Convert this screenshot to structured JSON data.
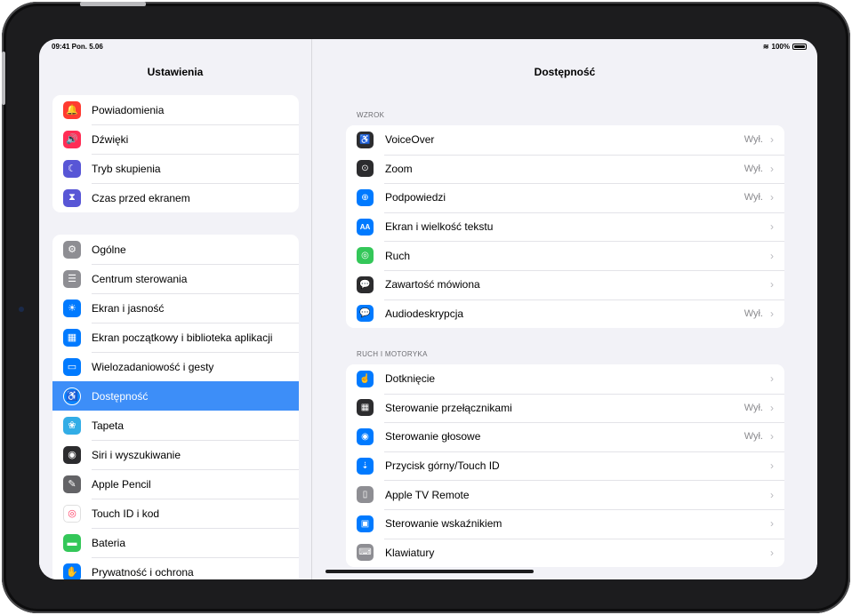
{
  "status": {
    "time": "09:41 Pon. 5.06",
    "battery": "100%"
  },
  "sidebar": {
    "title": "Ustawienia",
    "group1": [
      {
        "label": "Powiadomienia",
        "icon": "bell-icon",
        "color": "#ff3b30",
        "glyph": "🔔"
      },
      {
        "label": "Dźwięki",
        "icon": "speaker-icon",
        "color": "#ff2d55",
        "glyph": "🔊"
      },
      {
        "label": "Tryb skupienia",
        "icon": "moon-icon",
        "color": "#5856d6",
        "glyph": "☾"
      },
      {
        "label": "Czas przed ekranem",
        "icon": "hourglass-icon",
        "color": "#5856d6",
        "glyph": "⧗"
      }
    ],
    "group2": [
      {
        "label": "Ogólne",
        "icon": "gear-icon",
        "color": "#8e8e93",
        "glyph": "⚙"
      },
      {
        "label": "Centrum sterowania",
        "icon": "toggles-icon",
        "color": "#8e8e93",
        "glyph": "☰"
      },
      {
        "label": "Ekran i jasność",
        "icon": "sun-icon",
        "color": "#007aff",
        "glyph": "☀"
      },
      {
        "label": "Ekran początkowy i biblioteka aplikacji",
        "icon": "home-screen-icon",
        "color": "#007aff",
        "glyph": "▦"
      },
      {
        "label": "Wielozadaniowość i gesty",
        "icon": "multitasking-icon",
        "color": "#007aff",
        "glyph": "▭"
      },
      {
        "label": "Dostępność",
        "icon": "accessibility-icon",
        "color": "#0a84ff",
        "glyph": "♿",
        "selected": true
      },
      {
        "label": "Tapeta",
        "icon": "wallpaper-icon",
        "color": "#32ade6",
        "glyph": "❀"
      },
      {
        "label": "Siri i wyszukiwanie",
        "icon": "siri-icon",
        "color": "#2c2c2e",
        "glyph": "◉"
      },
      {
        "label": "Apple Pencil",
        "icon": "pencil-icon",
        "color": "#636366",
        "glyph": "✎"
      },
      {
        "label": "Touch ID i kod",
        "icon": "fingerprint-icon",
        "color": "#ffffff",
        "glyph": "◎"
      },
      {
        "label": "Bateria",
        "icon": "battery-icon",
        "color": "#34c759",
        "glyph": "▬"
      },
      {
        "label": "Prywatność i ochrona",
        "icon": "hand-icon",
        "color": "#007aff",
        "glyph": "✋"
      }
    ]
  },
  "main": {
    "title": "Dostępność",
    "section1": {
      "header": "WZROK",
      "items": [
        {
          "label": "VoiceOver",
          "value": "Wył.",
          "icon": "voiceover-icon",
          "color": "#2c2c2e",
          "glyph": "♿"
        },
        {
          "label": "Zoom",
          "value": "Wył.",
          "icon": "zoom-icon",
          "color": "#2c2c2e",
          "glyph": "⊙"
        },
        {
          "label": "Podpowiedzi",
          "value": "Wył.",
          "icon": "hover-text-icon",
          "color": "#007aff",
          "glyph": "⊕"
        },
        {
          "label": "Ekran i wielkość tekstu",
          "value": "",
          "icon": "text-size-icon",
          "color": "#007aff",
          "glyph": "AA"
        },
        {
          "label": "Ruch",
          "value": "",
          "icon": "motion-icon",
          "color": "#34c759",
          "glyph": "◎"
        },
        {
          "label": "Zawartość mówiona",
          "value": "",
          "icon": "spoken-content-icon",
          "color": "#2c2c2e",
          "glyph": "💬"
        },
        {
          "label": "Audiodeskrypcja",
          "value": "Wył.",
          "icon": "audio-description-icon",
          "color": "#007aff",
          "glyph": "💬"
        }
      ]
    },
    "section2": {
      "header": "RUCH I MOTORYKA",
      "items": [
        {
          "label": "Dotknięcie",
          "value": "",
          "icon": "touch-icon",
          "color": "#007aff",
          "glyph": "☝"
        },
        {
          "label": "Sterowanie przełącznikami",
          "value": "Wył.",
          "icon": "switch-control-icon",
          "color": "#2c2c2e",
          "glyph": "▦"
        },
        {
          "label": "Sterowanie głosowe",
          "value": "Wył.",
          "icon": "voice-control-icon",
          "color": "#007aff",
          "glyph": "◉"
        },
        {
          "label": "Przycisk górny/Touch ID",
          "value": "",
          "icon": "top-button-icon",
          "color": "#007aff",
          "glyph": "⇣"
        },
        {
          "label": "Apple TV Remote",
          "value": "",
          "icon": "remote-icon",
          "color": "#8e8e93",
          "glyph": "▯"
        },
        {
          "label": "Sterowanie wskaźnikiem",
          "value": "",
          "icon": "pointer-icon",
          "color": "#007aff",
          "glyph": "▣"
        },
        {
          "label": "Klawiatury",
          "value": "",
          "icon": "keyboard-icon",
          "color": "#8e8e93",
          "glyph": "⌨"
        }
      ]
    }
  }
}
